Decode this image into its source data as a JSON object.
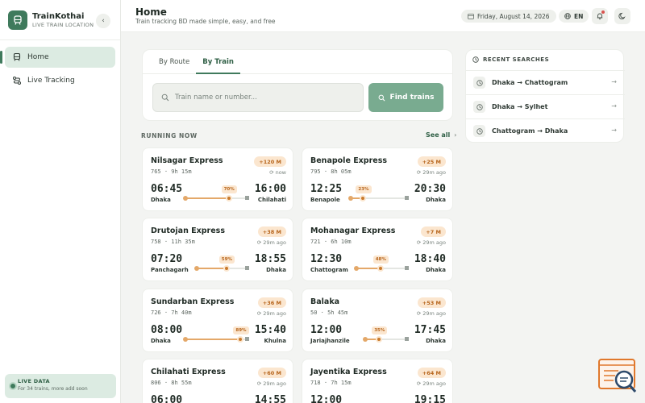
{
  "brand": {
    "name": "TrainKothai",
    "subtitle": "LIVE TRAIN LOCATION"
  },
  "sidebar": {
    "items": [
      {
        "label": "Home",
        "icon": "train-icon",
        "active": true
      },
      {
        "label": "Live Tracking",
        "icon": "route-icon",
        "active": false
      }
    ],
    "live_box": {
      "title": "LIVE DATA",
      "subtitle": "For 34 trains, more add soon"
    }
  },
  "header": {
    "title": "Home",
    "subtitle": "Train tracking BD made simple, easy, and free",
    "date": "Friday, August 14, 2026",
    "language": "EN"
  },
  "search": {
    "tabs": [
      {
        "label": "By Route",
        "active": false
      },
      {
        "label": "By Train",
        "active": true
      }
    ],
    "placeholder": "Train name or number...",
    "button_label": "Find trains"
  },
  "running": {
    "title": "RUNNING NOW",
    "see_all": "See all",
    "trains": [
      {
        "name": "Nilsagar Express",
        "meta": "765 · 9h 15m",
        "delay": "+120 M",
        "updated": "now",
        "dep": "06:45",
        "arr": "16:00",
        "from": "Dhaka",
        "to": "Chilahati",
        "progress": 70
      },
      {
        "name": "Benapole Express",
        "meta": "795 · 8h 05m",
        "delay": "+25 M",
        "updated": "29m ago",
        "dep": "12:25",
        "arr": "20:30",
        "from": "Benapole",
        "to": "Dhaka",
        "progress": 23
      },
      {
        "name": "Drutojan Express",
        "meta": "758 · 11h 35m",
        "delay": "+38 M",
        "updated": "29m ago",
        "dep": "07:20",
        "arr": "18:55",
        "from": "Panchagarh",
        "to": "Dhaka",
        "progress": 59
      },
      {
        "name": "Mohanagar Express",
        "meta": "721 · 6h 10m",
        "delay": "+7 M",
        "updated": "29m ago",
        "dep": "12:30",
        "arr": "18:40",
        "from": "Chattogram",
        "to": "Dhaka",
        "progress": 48
      },
      {
        "name": "Sundarban Express",
        "meta": "726 · 7h 40m",
        "delay": "+36 M",
        "updated": "29m ago",
        "dep": "08:00",
        "arr": "15:40",
        "from": "Dhaka",
        "to": "Khulna",
        "progress": 89
      },
      {
        "name": "Balaka",
        "meta": "50 · 5h 45m",
        "delay": "+53 M",
        "updated": "29m ago",
        "dep": "12:00",
        "arr": "17:45",
        "from": "Jariajhanzile",
        "to": "Dhaka",
        "progress": 35
      },
      {
        "name": "Chilahati Express",
        "meta": "806 · 8h 55m",
        "delay": "+60 M",
        "updated": "29m ago",
        "dep": "06:00",
        "arr": "14:55",
        "from": "",
        "to": "",
        "progress": 0
      },
      {
        "name": "Jayentika Express",
        "meta": "718 · 7h 15m",
        "delay": "+64 M",
        "updated": "29m ago",
        "dep": "12:00",
        "arr": "19:15",
        "from": "",
        "to": "",
        "progress": 0
      }
    ]
  },
  "recent": {
    "title": "RECENT SEARCHES",
    "items": [
      {
        "label": "Dhaka → Chattogram"
      },
      {
        "label": "Dhaka → Sylhet"
      },
      {
        "label": "Chattogram → Dhaka"
      }
    ]
  },
  "colors": {
    "accent": "#3f7a5c",
    "accent_light": "#dcebe2",
    "delay": "#b7651c",
    "delay_bg": "#fbe6cf"
  }
}
